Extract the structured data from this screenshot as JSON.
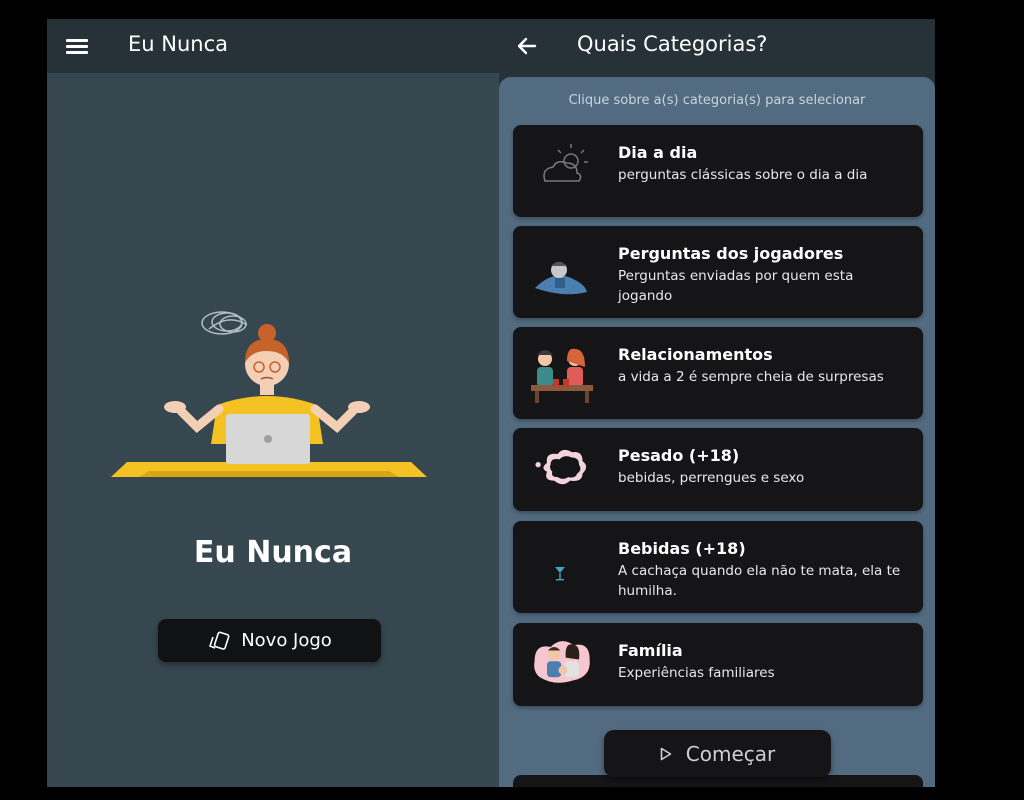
{
  "left": {
    "appbar_title": "Eu Nunca",
    "app_name": "Eu Nunca",
    "new_game_label": "Novo Jogo"
  },
  "right": {
    "appbar_title": "Quais Categorias?",
    "hint": "Clique sobre a(s) categoria(s) para selecionar",
    "categories": [
      {
        "title": "Dia a dia",
        "desc": "perguntas clássicas sobre o dia a dia",
        "icon": "cloud-sun-icon"
      },
      {
        "title": "Perguntas dos jogadores",
        "desc": "Perguntas enviadas por quem esta jogando",
        "icon": "players-icon"
      },
      {
        "title": "Relacionamentos",
        "desc": "a vida a 2 é sempre cheia de surpresas",
        "icon": "couple-icon"
      },
      {
        "title": "Pesado (+18)",
        "desc": "bebidas, perrengues e sexo",
        "icon": "smoke-cloud-icon"
      },
      {
        "title": "Bebidas (+18)",
        "desc": "A cachaça quando ela não te mata, ela te humilha.",
        "icon": "cocktail-glass-icon"
      },
      {
        "title": "Família",
        "desc": "Experiências familiares",
        "icon": "family-icon"
      }
    ],
    "start_label": "Começar"
  },
  "colors": {
    "left_background": "#37474f",
    "appbar": "#263238",
    "panel": "#526b80",
    "card": "#151517",
    "accent_yellow": "#f4c323"
  }
}
